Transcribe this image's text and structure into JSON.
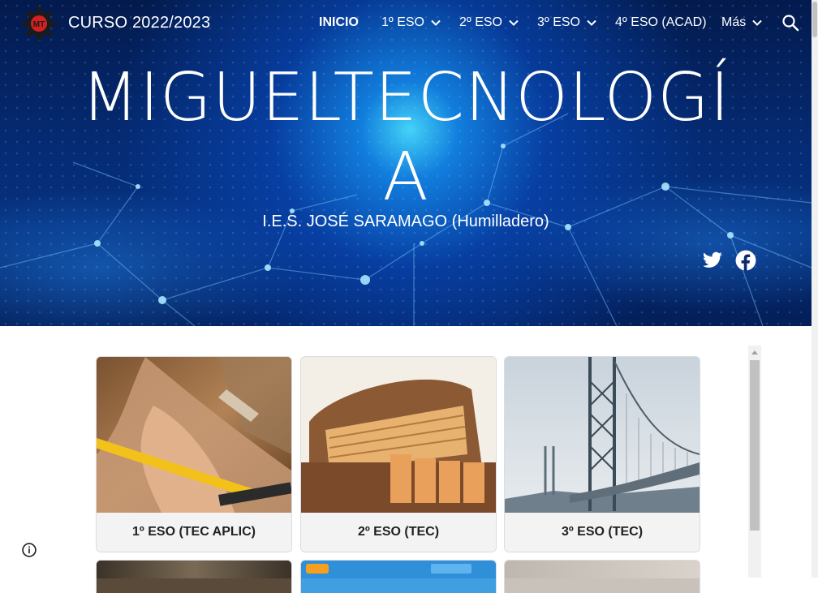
{
  "header": {
    "site_name": "CURSO 2022/2023",
    "nav": [
      {
        "label": "INICIO",
        "active": true,
        "has_dropdown": false
      },
      {
        "label": "1º ESO",
        "active": false,
        "has_dropdown": true
      },
      {
        "label": "2º ESO",
        "active": false,
        "has_dropdown": true
      },
      {
        "label": "3º ESO",
        "active": false,
        "has_dropdown": true
      },
      {
        "label": "4º ESO (ACAD)",
        "active": false,
        "has_dropdown": false
      },
      {
        "label": "Más",
        "active": false,
        "has_dropdown": true
      }
    ],
    "search_icon": "search-icon",
    "logo_text": "MT"
  },
  "hero": {
    "title_line1": "MIGUELTECNOLOGÍ",
    "title_line2": "A",
    "subtitle": "I.E.S. JOSÉ SARAMAGO (Humilladero)",
    "social": [
      "twitter-icon",
      "facebook-icon"
    ]
  },
  "cards": [
    {
      "label": "1º ESO (TEC APLIC)"
    },
    {
      "label": "2º ESO (TEC)"
    },
    {
      "label": "3º ESO (TEC)"
    }
  ],
  "colors": {
    "hero_dark": "#031a4d",
    "hero_glow": "#46dcff",
    "text_dark": "#212121",
    "card_border": "#dadce0"
  }
}
